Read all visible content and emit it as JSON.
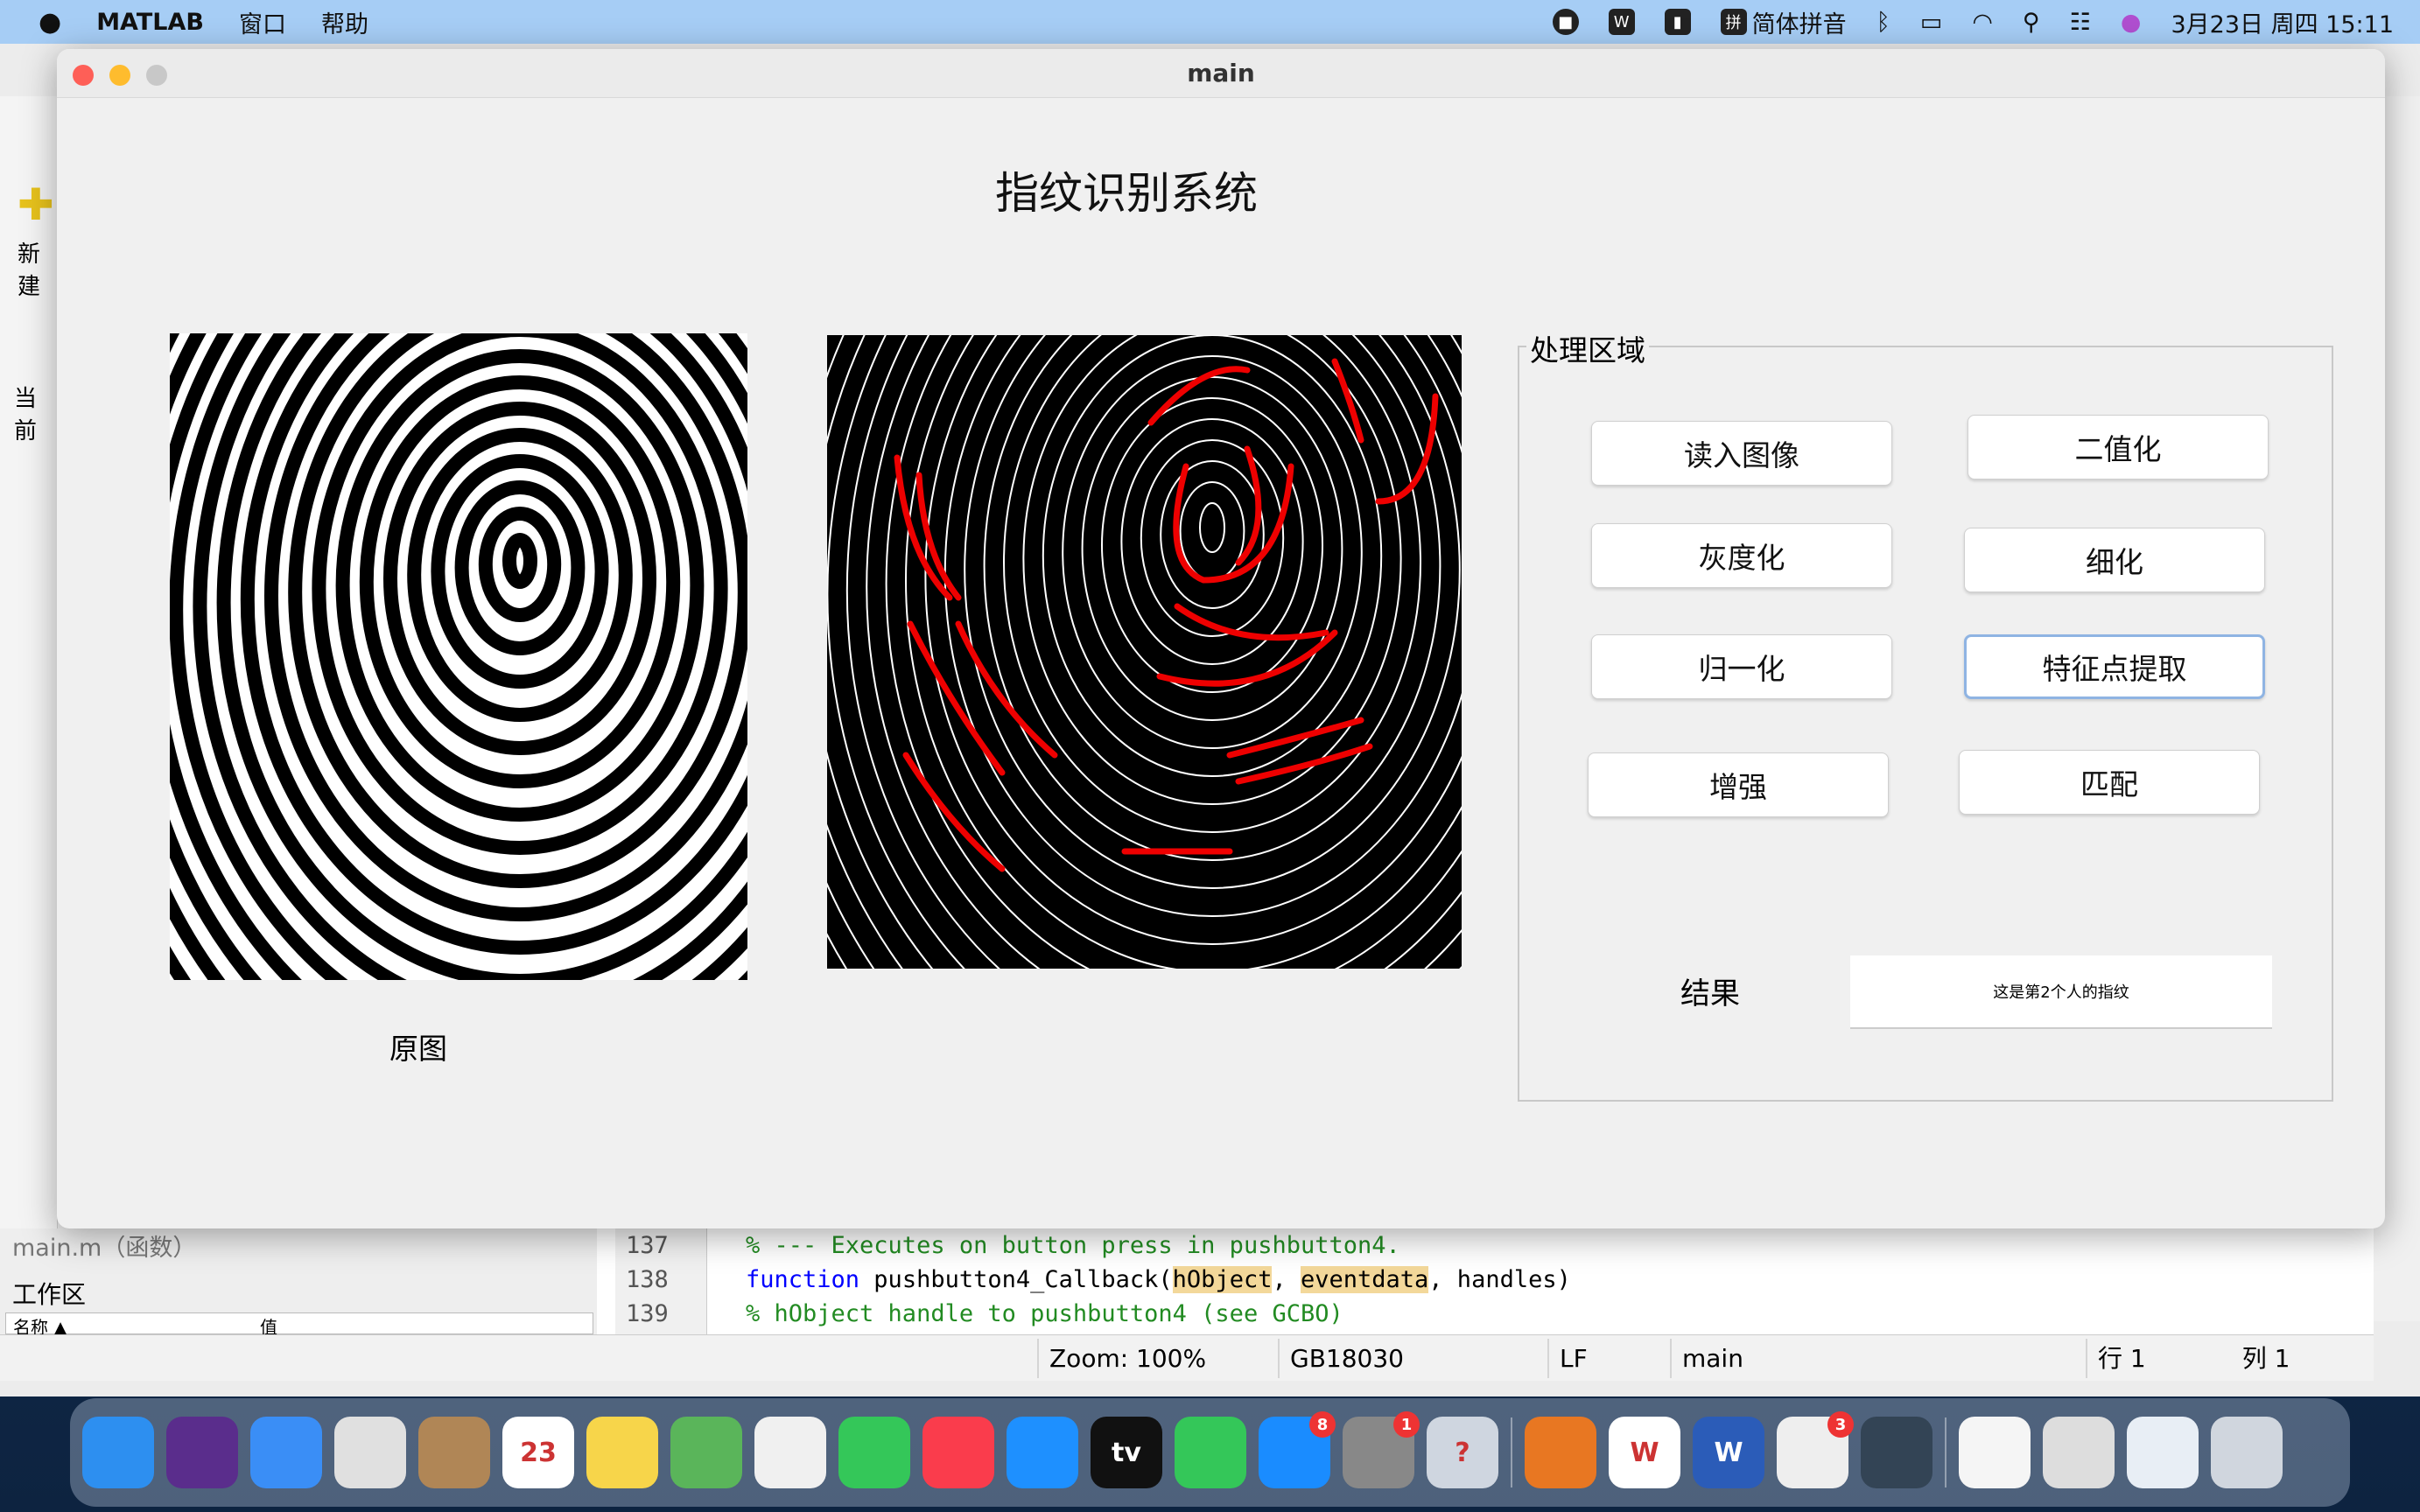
{
  "menubar": {
    "app": "MATLAB",
    "items": [
      "窗口",
      "帮助"
    ],
    "input_method": "简体拼音",
    "datetime": "3月23日 周四 15:11"
  },
  "matlab": {
    "left_labels": [
      "新建",
      "当前"
    ],
    "panel_file": "main.m（函数）",
    "workspace": "工作区",
    "ws_columns": [
      "名称 ▲",
      "值"
    ],
    "code": {
      "lines": [
        {
          "no": "137",
          "text": "% --- Executes on button press in pushbutton4."
        },
        {
          "no": "138",
          "kw": "function",
          "fn": " pushbutton4_Callback(",
          "a1": "hObject",
          "sep": ", ",
          "a2": "eventdata",
          "rest": ", handles)"
        },
        {
          "no": "139",
          "text": "% hObject    handle to pushbutton4 (see GCBO)"
        }
      ]
    },
    "status": {
      "zoom": "Zoom: 100%",
      "encoding": "GB18030",
      "eol": "LF",
      "file": "main",
      "row_label": "行",
      "row": "1",
      "col_label": "列",
      "col": "1"
    }
  },
  "figure": {
    "window_title": "main",
    "heading": "指纹识别系统",
    "original_caption": "原图",
    "panel_title": "处理区域",
    "buttons": {
      "read": "读入图像",
      "binarize": "二值化",
      "gray": "灰度化",
      "thin": "细化",
      "normalize": "归一化",
      "feature": "特征点提取",
      "enhance": "增强",
      "match": "匹配"
    },
    "result_label": "结果",
    "result_value": "这是第2个人的指纹"
  },
  "dock": {
    "apps": [
      {
        "name": "finder",
        "color": "#2d8ff0"
      },
      {
        "name": "siri",
        "color": "#5a2d8c"
      },
      {
        "name": "mail",
        "color": "#3a8ef6"
      },
      {
        "name": "launchpad",
        "color": "#e0e0e0"
      },
      {
        "name": "contacts",
        "color": "#b08656"
      },
      {
        "name": "calendar",
        "color": "#ffffff",
        "label": "23"
      },
      {
        "name": "notes",
        "color": "#f7d54a"
      },
      {
        "name": "maps",
        "color": "#5ab55a"
      },
      {
        "name": "photos",
        "color": "#f0f0f0"
      },
      {
        "name": "messages",
        "color": "#34c759"
      },
      {
        "name": "music",
        "color": "#fa3c4c"
      },
      {
        "name": "safari",
        "color": "#1e90ff"
      },
      {
        "name": "tv",
        "color": "#111111",
        "label": "tv"
      },
      {
        "name": "facetime",
        "color": "#34c759"
      },
      {
        "name": "app-store",
        "color": "#1a8cff",
        "badge": "8"
      },
      {
        "name": "system-settings",
        "color": "#888888",
        "badge": "1"
      },
      {
        "name": "help",
        "color": "#cfd6e0",
        "label": "?"
      },
      {
        "name": "matlab",
        "color": "#e87722"
      },
      {
        "name": "wps",
        "color": "#ffffff",
        "label": "W"
      },
      {
        "name": "word",
        "color": "#2b5cb8",
        "label": "W"
      },
      {
        "name": "installer",
        "color": "#eeeeee",
        "badge": "3"
      },
      {
        "name": "quicktime",
        "color": "#334455"
      },
      {
        "name": "window-1",
        "color": "#f5f5f5"
      },
      {
        "name": "window-2",
        "color": "#dddddd"
      },
      {
        "name": "window-3",
        "color": "#e8eef5"
      },
      {
        "name": "trash",
        "color": "#d0d6de"
      }
    ]
  }
}
